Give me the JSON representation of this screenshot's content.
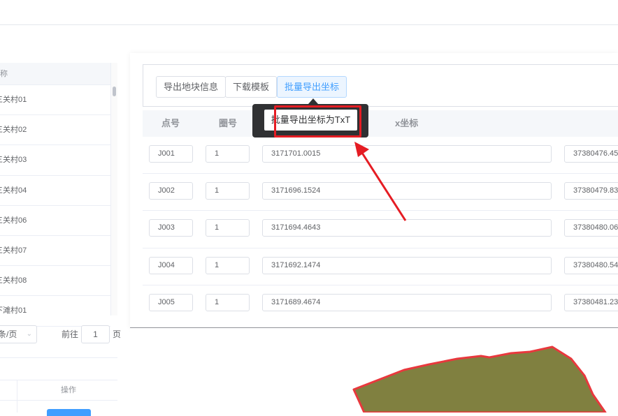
{
  "left_table": {
    "header_label": "称",
    "rows": [
      "三关村01",
      "三关村02",
      "三关村03",
      "三关村04",
      "三关村06",
      "三关村07",
      "三关村08",
      "下滩村01"
    ]
  },
  "pager": {
    "page_size_label": "条/页",
    "goto_label": "前往",
    "goto_value": "1",
    "page_unit": "页"
  },
  "left_bottom_table": {
    "operation_header": "操作"
  },
  "toolbar": {
    "export_parcel_label": "导出地块信息",
    "download_template_label": "下载模板",
    "batch_export_label": "批量导出坐标"
  },
  "tooltip": {
    "text": "批量导出坐标为TxT"
  },
  "grid": {
    "headers": {
      "point": "点号",
      "ring": "圈号",
      "x": "x坐标"
    },
    "rows": [
      {
        "point": "J001",
        "ring": "1",
        "x": "3171701.0015",
        "y": "37380476.45"
      },
      {
        "point": "J002",
        "ring": "1",
        "x": "3171696.1524",
        "y": "37380479.83"
      },
      {
        "point": "J003",
        "ring": "1",
        "x": "3171694.4643",
        "y": "37380480.06"
      },
      {
        "point": "J004",
        "ring": "1",
        "x": "3171692.1474",
        "y": "37380480.54"
      },
      {
        "point": "J005",
        "ring": "1",
        "x": "3171689.4674",
        "y": "37380481.23"
      }
    ]
  },
  "colors": {
    "primary": "#409eff",
    "annotation_red": "#e51c23",
    "parcel_fill": "#808040",
    "parcel_stroke": "#e8383d"
  }
}
